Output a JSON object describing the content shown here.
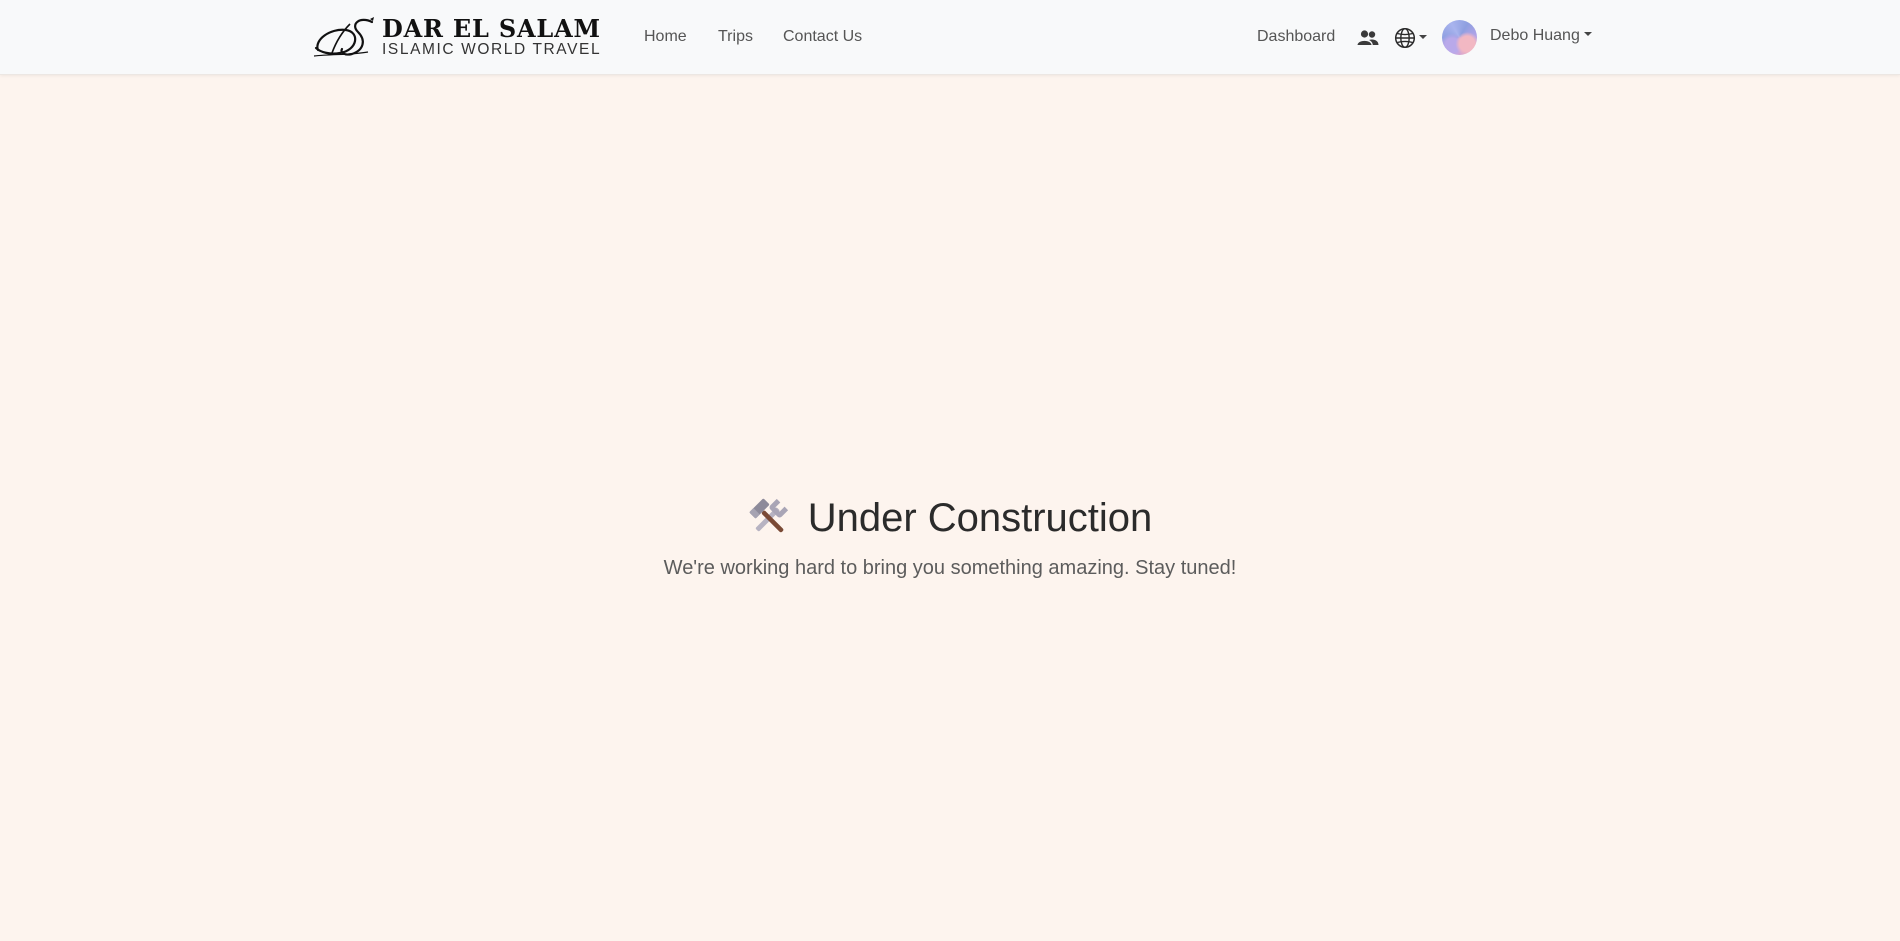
{
  "brand": {
    "title": "DAR EL SALAM",
    "subtitle": "ISLAMIC WORLD TRAVEL"
  },
  "nav": {
    "items": [
      {
        "label": "Home"
      },
      {
        "label": "Trips"
      },
      {
        "label": "Contact Us"
      }
    ],
    "dashboard": "Dashboard",
    "icons": [
      "people-icon",
      "globe-icon"
    ]
  },
  "user": {
    "name": "Debo Huang"
  },
  "hero": {
    "icon": "hammer-and-wrench-icon",
    "title": "Under Construction",
    "subtitle": "We're working hard to bring you something amazing. Stay tuned!"
  },
  "colors": {
    "page_background": "#fdf4ee",
    "navbar_background": "#f8f9fa",
    "nav_text": "#555555",
    "heading_text": "#2b2b2b",
    "subtitle_text": "#5c5c5c"
  }
}
